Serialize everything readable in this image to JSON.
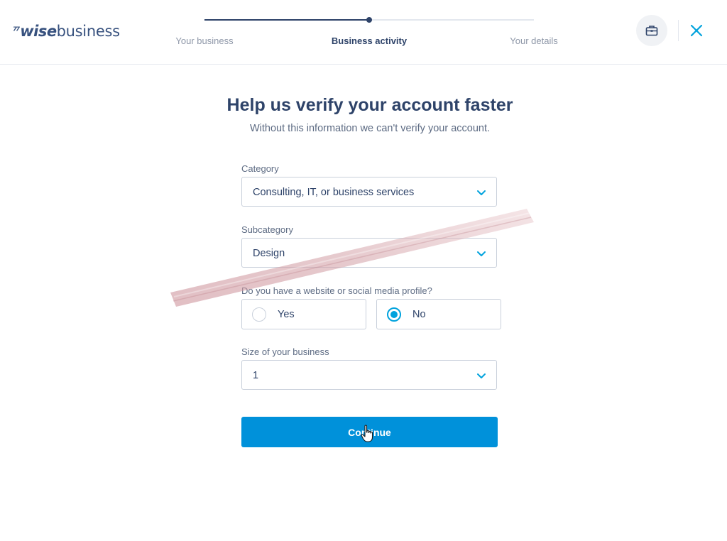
{
  "header": {
    "logo_mark": "⁷",
    "logo_wise": "wise",
    "logo_business": "business",
    "steps": [
      {
        "label": "Your business",
        "active": false
      },
      {
        "label": "Business activity",
        "active": true
      },
      {
        "label": "Your details",
        "active": false
      }
    ],
    "progress": 0.5,
    "briefcase_icon": "briefcase-icon",
    "close_icon": "close-icon"
  },
  "main": {
    "title": "Help us verify your account faster",
    "subtitle": "Without this information we can't verify your account.",
    "category": {
      "label": "Category",
      "value": "Consulting, IT, or business services"
    },
    "subcategory": {
      "label": "Subcategory",
      "value": "Design"
    },
    "website_question": {
      "label": "Do you have a website or social media profile?",
      "options": [
        {
          "label": "Yes",
          "selected": false
        },
        {
          "label": "No",
          "selected": true
        }
      ]
    },
    "business_size": {
      "label": "Size of your business",
      "value": "1"
    },
    "continue_label": "Continue"
  },
  "colors": {
    "brand_navy": "#2e4369",
    "accent_blue": "#0091da",
    "radio_blue": "#00a2dd"
  }
}
